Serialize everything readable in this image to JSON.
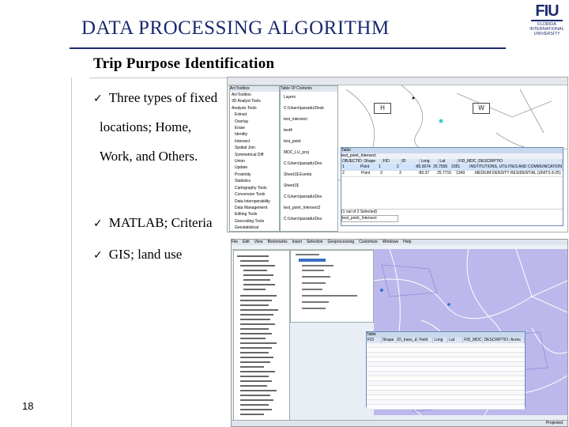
{
  "slide": {
    "title": "DATA PROCESSING ALGORITHM",
    "subtitle": "Trip Purpose Identification",
    "bullets": [
      "Three types of fixed",
      "locations; Home,",
      "Work, and Others.",
      "MATLAB; Criteria",
      "GIS; land use"
    ],
    "slide_number": "18",
    "logo": {
      "text": "FIU",
      "subtext": "FLORIDA INTERNATIONAL UNIVERSITY"
    }
  },
  "screenshot1": {
    "toolbox_title": "ArcToolbox",
    "toolbox_items": [
      "ArcToolbox",
      "3D Analyst Tools",
      "Analysis Tools",
      "Extract",
      "Overlay",
      "Erase",
      "Identity",
      "Intersect",
      "Spatial Join",
      "Symmetrical Diff",
      "Union",
      "Update",
      "Proximity",
      "Statistics",
      "Cartography Tools",
      "Conversion Tools",
      "Data Interoperability",
      "Data Management",
      "Editing Tools",
      "Geocoding Tools",
      "Geostatistical"
    ],
    "toc_title": "Table Of Contents",
    "toc_items": [
      "Layers",
      "C:\\Users\\jassadu\\Desk",
      "test_intersect",
      "test4",
      "test_point",
      "MDC_LU_proj",
      "C:\\Users\\jassadu\\Des",
      "Sheet1$ Events",
      "Sheet1$",
      "C:\\Users\\jassadu\\Des",
      "test_point_Intersect2",
      "C:\\Users\\jassadu\\Des"
    ],
    "map_labels": {
      "home": "H",
      "work": "W"
    },
    "table": {
      "title": "Table",
      "layer": "test_point_Intersect",
      "columns": [
        "OBJECTID",
        "Shape",
        "FID",
        "ID",
        "Long",
        "Lat",
        "FID_MDC",
        "DESCRIPTIO"
      ],
      "rows": [
        [
          "1",
          "Point",
          "1",
          "2",
          "-80.3674",
          "25.7565",
          "2351",
          "INSTITUTIONS, UTILITIES AND COMMUNICATION"
        ],
        [
          "2",
          "Point",
          "3",
          "3",
          "-80.37",
          "25.7715",
          "1349",
          "MEDIUM-DENSITY RESIDENTIAL (UNITS 8-25)"
        ]
      ],
      "footer": "(1 out of 2 Selected)",
      "tab": "test_point_Intersect"
    }
  },
  "screenshot2": {
    "menu": [
      "File",
      "Edit",
      "View",
      "Bookmarks",
      "Insert",
      "Selection",
      "Geoprocessing",
      "Customize",
      "Windows",
      "Help"
    ],
    "table_title": "Table",
    "columns": [
      "FID",
      "Shape",
      "ID_trans_d",
      "Field",
      "Long",
      "Lat",
      "FID_MDC",
      "DESCRIPTIO",
      "Acres"
    ],
    "row_count": 14,
    "status": "Projected"
  },
  "colors": {
    "title": "#1a2a6e",
    "map_purple": "#bcb8ec",
    "table_header": "#dbe6f4"
  }
}
